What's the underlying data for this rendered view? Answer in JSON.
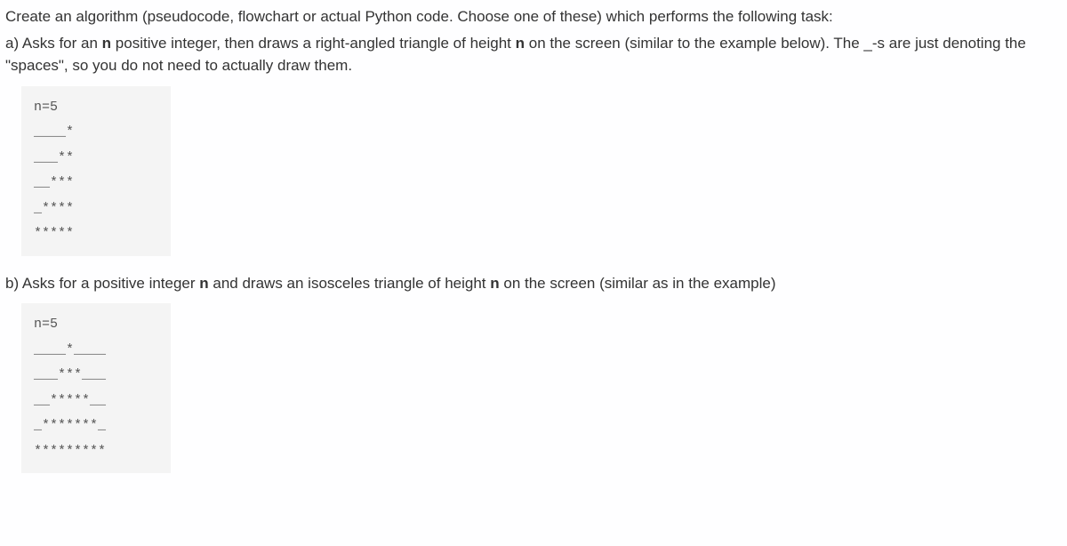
{
  "intro": "Create an algorithm (pseudocode, flowchart or actual Python code. Choose one of these) which performs the following task:",
  "partA": {
    "prefix": "a) Asks for an ",
    "bold1": "n",
    "mid1": " positive integer, then draws a right-angled triangle of height ",
    "bold2": "n",
    "mid2": " on the screen (similar to the example below). The _-s are just denoting the \"spaces\", so you do not need to actually draw them."
  },
  "codeA": {
    "lines": [
      "n=5",
      "",
      "____*",
      "___**",
      "__***",
      "_****",
      "*****"
    ]
  },
  "partB": {
    "prefix": "b) Asks for a positive integer ",
    "bold1": "n",
    "mid1": " and draws an isosceles triangle of height ",
    "bold2": "n",
    "mid2": " on the screen (similar as in the example)"
  },
  "codeB": {
    "lines": [
      "n=5",
      "",
      "____*____",
      "___***___",
      "__*****__",
      "_*******_",
      "*********"
    ]
  }
}
